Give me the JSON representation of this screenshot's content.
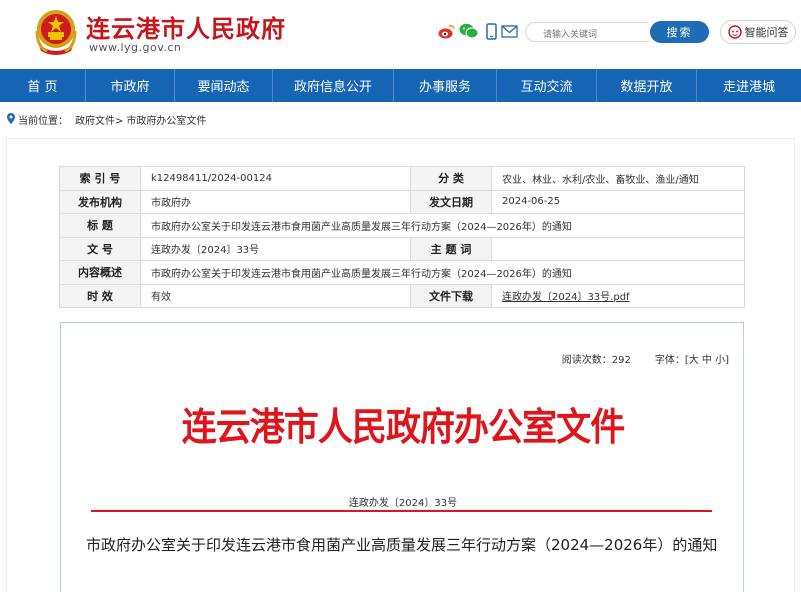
{
  "header": {
    "site_title": "连云港市人民政府",
    "site_url": "www.lyg.gov.cn",
    "search_placeholder": "请输入关键词",
    "search_button": "搜索",
    "qa_button": "智能问答"
  },
  "nav": {
    "items": [
      "首  页",
      "市政府",
      "要闻动态",
      "政府信息公开",
      "办事服务",
      "互动交流",
      "数据开放",
      "走进港城"
    ]
  },
  "breadcrumb": {
    "label": "当前位置：",
    "path1": "政府文件>",
    "path2": "市政府办公室文件"
  },
  "info": {
    "index_key": "索 引 号",
    "index_val": "k12498411/2024-00124",
    "category_key": "分    类",
    "category_val": "农业、林业、水利/农业、畜牧业、渔业/通知",
    "publisher_key": "发布机构",
    "publisher_val": "市政府办",
    "date_key": "发文日期",
    "date_val": "2024-06-25",
    "title_key": "标    题",
    "title_val": "市政府办公室关于印发连云港市食用菌产业高质量发展三年行动方案（2024—2026年）的通知",
    "docno_key": "文    号",
    "docno_val": "连政办发〔2024〕33号",
    "subject_key": "主 题 词",
    "subject_val": "",
    "summary_key": "内容概述",
    "summary_val": "市政府办公室关于印发连云港市食用菌产业高质量发展三年行动方案（2024—2026年）的通知",
    "validity_key": "时    效",
    "validity_val": "有效",
    "download_key": "文件下载",
    "download_val": "连政办发〔2024〕33号.pdf"
  },
  "doc": {
    "read_count": "阅读次数：292",
    "font_size": "字体：[大 中 小]",
    "heading": "连云港市人民政府办公室文件",
    "doc_no": "连政办发〔2024〕33号",
    "title": "市政府办公室关于印发连云港市食用菌产业高质量发展三年行动方案（2024—2026年）的通知"
  },
  "colors": {
    "brand_blue": "#1664b4",
    "brand_red": "#c8151b",
    "doc_red": "#e0141b"
  },
  "icons": [
    "national-emblem",
    "weibo-icon",
    "wechat-icon",
    "mobile-icon",
    "mail-icon",
    "robot-icon",
    "location-pin-icon"
  ]
}
